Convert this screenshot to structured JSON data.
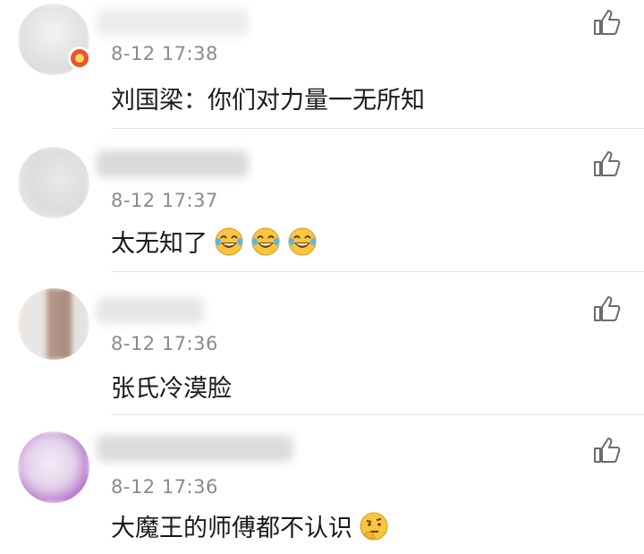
{
  "comments": [
    {
      "time": "8-12 17:38",
      "text": "刘国梁：你们对力量一无所知",
      "emoji_icons": []
    },
    {
      "time": "8-12 17:37",
      "text": "太无知了",
      "emoji_icons": [
        "laugh-cry-icon",
        "laugh-cry-icon",
        "laugh-cry-icon"
      ]
    },
    {
      "time": "8-12 17:36",
      "text": "张氏冷漠脸",
      "emoji_icons": []
    },
    {
      "time": "8-12 17:36",
      "text": "大魔王的师傅都不认识",
      "emoji_icons": [
        "thinking-face-icon"
      ]
    }
  ],
  "like_icon": "thumbs-up-outline-icon",
  "colors": {
    "time_text": "#8a8a8a",
    "body_text": "#1a1a1a",
    "divider": "#e3e3e3",
    "badge": "#e8572a"
  }
}
